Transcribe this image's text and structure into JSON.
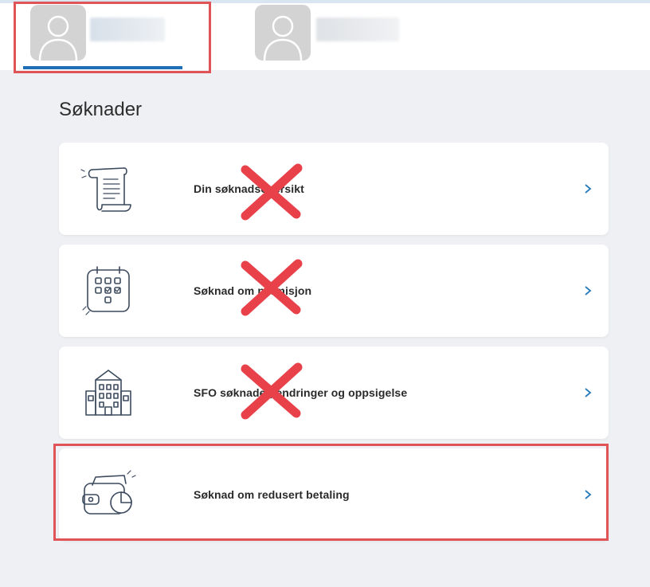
{
  "header": {
    "profiles": [
      {
        "avatar_icon": "person-silhouette-icon",
        "name_state": "blurred",
        "active": true
      },
      {
        "avatar_icon": "person-silhouette-icon",
        "name_state": "blurred",
        "active": false
      }
    ],
    "active_indicator_color": "#1f6fb8"
  },
  "main": {
    "title": "Søknader",
    "cards": [
      {
        "label": "Din søknadsoversikt",
        "icon": "scroll-document-icon",
        "crossed_out": true
      },
      {
        "label": "Søknad om permisjon",
        "icon": "calendar-checklist-icon",
        "crossed_out": true
      },
      {
        "label": "SFO søknader, endringer og oppsigelse",
        "icon": "school-building-icon",
        "crossed_out": true
      },
      {
        "label": "Søknad om redusert betaling",
        "icon": "wallet-pie-chart-icon",
        "crossed_out": false,
        "highlighted": true
      }
    ],
    "chevron_icon": "chevron-right-icon"
  },
  "annotations": {
    "highlight_color": "#e05356",
    "cross_color": "#e8414a"
  }
}
